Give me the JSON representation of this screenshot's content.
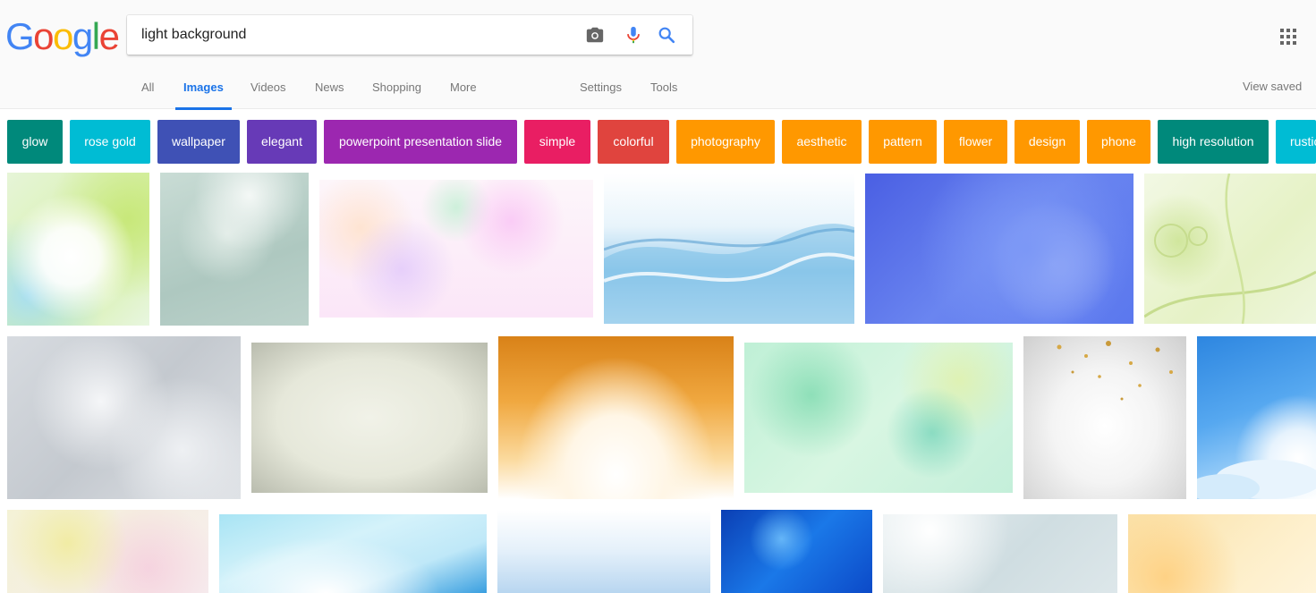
{
  "logo": {
    "letters": [
      "G",
      "o",
      "o",
      "g",
      "l",
      "e"
    ],
    "colors": [
      "#4285f4",
      "#ea4335",
      "#fbbc05",
      "#4285f4",
      "#34a853",
      "#ea4335"
    ]
  },
  "search": {
    "query": "light background",
    "camera_icon": "camera-icon",
    "mic_icon": "mic-icon",
    "search_icon": "search-icon"
  },
  "tabs": {
    "all": "All",
    "images": "Images",
    "videos": "Videos",
    "news": "News",
    "shopping": "Shopping",
    "more": "More",
    "settings": "Settings",
    "tools": "Tools",
    "view_saved": "View saved"
  },
  "chips": [
    {
      "label": "glow",
      "color": "#00897b"
    },
    {
      "label": "rose gold",
      "color": "#00bcd4"
    },
    {
      "label": "wallpaper",
      "color": "#3f51b5"
    },
    {
      "label": "elegant",
      "color": "#673ab7"
    },
    {
      "label": "powerpoint presentation slide",
      "color": "#9c27b0"
    },
    {
      "label": "simple",
      "color": "#e91e63"
    },
    {
      "label": "colorful",
      "color": "#e0443e"
    },
    {
      "label": "photography",
      "color": "#ff9800"
    },
    {
      "label": "aesthetic",
      "color": "#ff9800"
    },
    {
      "label": "pattern",
      "color": "#ff9800"
    },
    {
      "label": "flower",
      "color": "#ff9800"
    },
    {
      "label": "design",
      "color": "#ff9800"
    },
    {
      "label": "phone",
      "color": "#ff9800"
    },
    {
      "label": "high resolution",
      "color": "#00897b"
    },
    {
      "label": "rustic",
      "color": "#00bcd4"
    }
  ],
  "results_count": 18
}
